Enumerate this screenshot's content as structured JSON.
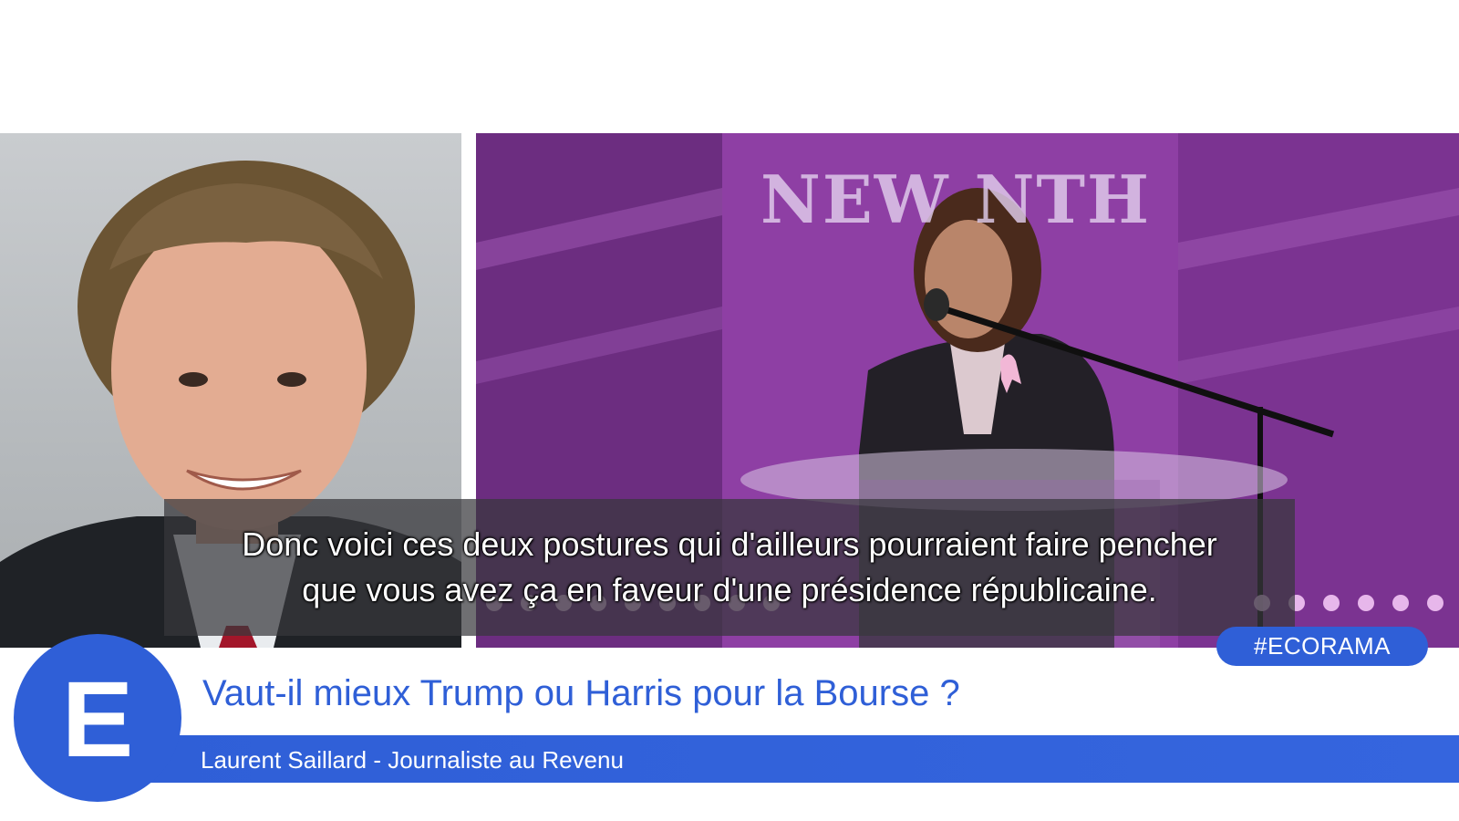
{
  "video": {
    "banner_text": "NEW NTH",
    "subtitle_lines": [
      "Donc voici ces deux postures qui d'ailleurs pourraient faire pencher",
      "que vous avez ça en faveur d'une présidence républicaine."
    ]
  },
  "lower_third": {
    "hashtag": "#ECORAMA",
    "title": "Vaut-il mieux Trump ou Harris pour la Bourse ?",
    "guest": "Laurent Saillard - Journaliste au Revenu",
    "logo_letter": "E"
  },
  "colors": {
    "brand_blue": "#2f5fd7",
    "stage_purple": "#8a3a9c",
    "subtitle_bg": "#37373c"
  },
  "icons": {
    "logo": "ecorama-e-logo",
    "microphone": "microphone-icon",
    "ribbon": "pink-ribbon-icon"
  }
}
